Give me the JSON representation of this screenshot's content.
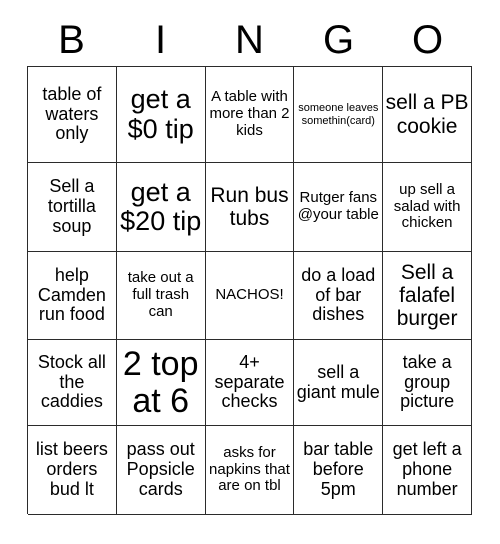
{
  "header": {
    "letters": [
      "B",
      "I",
      "N",
      "G",
      "O"
    ]
  },
  "grid": {
    "rows": 5,
    "columns": 5,
    "border_color": "#2b2b2b",
    "background_color": "#ffffff",
    "text_color": "#000000",
    "cells": [
      {
        "text": "table of waters only",
        "size": "md"
      },
      {
        "text": "get a\n$0 tip",
        "size": "xl"
      },
      {
        "text": "A table with more than 2 kids",
        "size": "sm"
      },
      {
        "text": "someone leaves somethin(card)",
        "size": "xs"
      },
      {
        "text": "sell a PB cookie",
        "size": "lg"
      },
      {
        "text": "Sell a tortilla soup",
        "size": "md"
      },
      {
        "text": "get a\n$20 tip",
        "size": "xl"
      },
      {
        "text": "Run bus tubs",
        "size": "lg"
      },
      {
        "text": "Rutger fans @your table",
        "size": "sm"
      },
      {
        "text": "up sell a salad with chicken",
        "size": "sm"
      },
      {
        "text": "help Camden run food",
        "size": "md"
      },
      {
        "text": "take out a full trash can",
        "size": "sm"
      },
      {
        "text": "NACHOS!",
        "size": "sm"
      },
      {
        "text": "do a load of bar dishes",
        "size": "md"
      },
      {
        "text": "Sell a falafel burger",
        "size": "lg"
      },
      {
        "text": "Stock all the caddies",
        "size": "md"
      },
      {
        "text": "2 top\nat 6",
        "size": "xxl"
      },
      {
        "text": "4+ separate checks",
        "size": "md"
      },
      {
        "text": "sell a giant mule",
        "size": "md"
      },
      {
        "text": "take a group picture",
        "size": "md"
      },
      {
        "text": "list beers orders bud lt",
        "size": "md"
      },
      {
        "text": "pass out Popsicle cards",
        "size": "md"
      },
      {
        "text": "asks for napkins that are on tbl",
        "size": "sm"
      },
      {
        "text": "bar table before 5pm",
        "size": "md"
      },
      {
        "text": "get left a phone number",
        "size": "md"
      }
    ]
  }
}
